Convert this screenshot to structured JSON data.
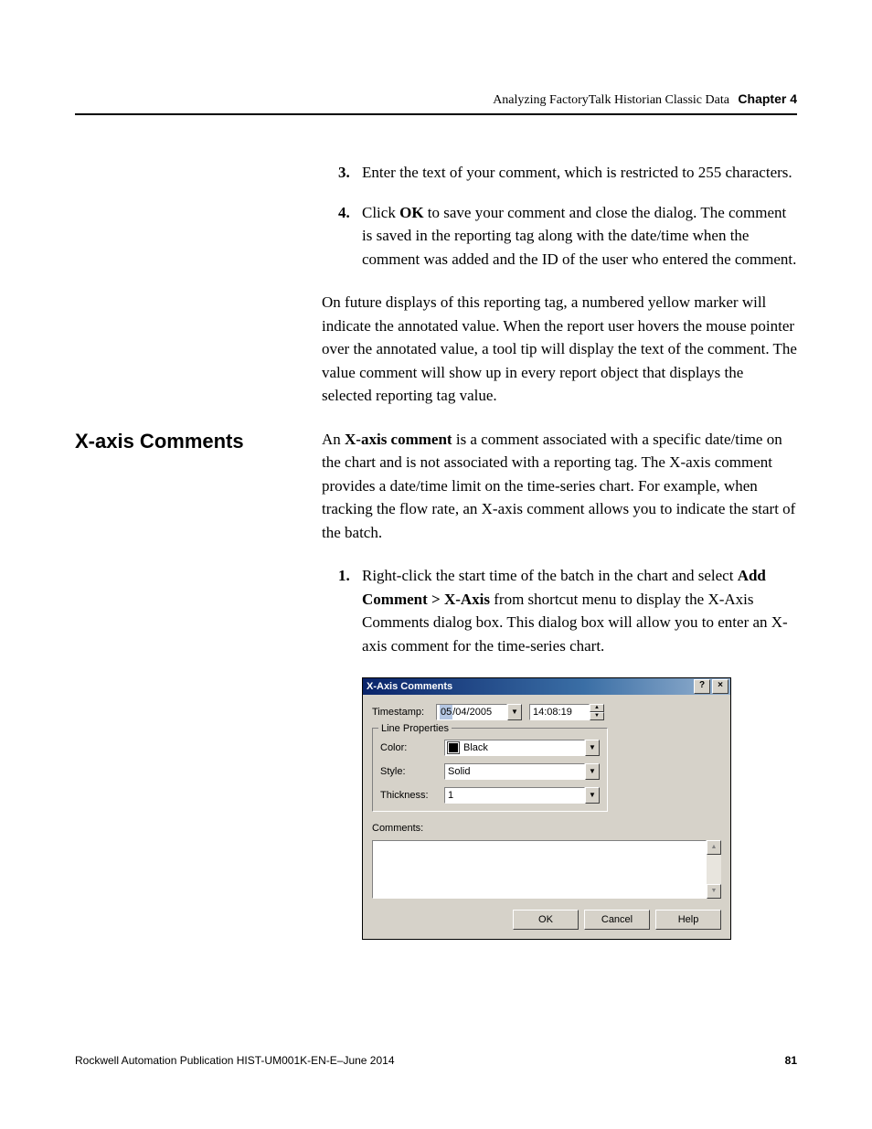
{
  "header": {
    "title": "Analyzing FactoryTalk Historian Classic Data",
    "chapter": "Chapter 4"
  },
  "step3": {
    "num": "3.",
    "text": "Enter the text of your comment, which is restricted to 255 characters."
  },
  "step4": {
    "num": "4.",
    "pre": "Click ",
    "bold": "OK",
    "post": " to save your comment and close the dialog. The comment is saved in the reporting tag along with the date/time when the comment was added and the ID of the user who entered the comment."
  },
  "para_future": "On future displays of this reporting tag, a numbered yellow marker will indicate the annotated value. When the report user hovers the mouse pointer over the annotated value, a tool tip will display the text of the comment. The value comment will show up in every report object that displays the selected reporting tag value.",
  "section_heading": "X-axis Comments",
  "para_xaxis_pre": "An ",
  "para_xaxis_bold": "X-axis comment",
  "para_xaxis_post": " is a comment associated with a specific date/time on the chart and is not associated with a reporting tag. The X-axis comment provides a date/time limit on the time-series chart. For example, when tracking the flow rate, an X-axis comment allows you to indicate the start of the batch.",
  "step1": {
    "num": "1.",
    "seg1": "Right-click the start time of the batch in the chart and select ",
    "bold": "Add Comment > X-Axis",
    "seg2": " from shortcut menu to display the X-Axis Comments dialog box. This dialog box will allow you to enter an X-axis comment for the time-series chart."
  },
  "dialog": {
    "title": "X-Axis Comments",
    "help_btn": "?",
    "close_btn": "×",
    "timestamp_label": "Timestamp:",
    "date_sel": "05",
    "date_rest": "/04/2005",
    "time_value": "14:08:19",
    "legend": "Line Properties",
    "color_label": "Color:",
    "color_value": "Black",
    "style_label": "Style:",
    "style_value": "Solid",
    "thickness_label": "Thickness:",
    "thickness_value": "1",
    "comments_label": "Comments:",
    "ok": "OK",
    "cancel": "Cancel",
    "help": "Help"
  },
  "footer": {
    "pub": "Rockwell Automation Publication HIST-UM001K-EN-E–June 2014",
    "page": "81"
  }
}
